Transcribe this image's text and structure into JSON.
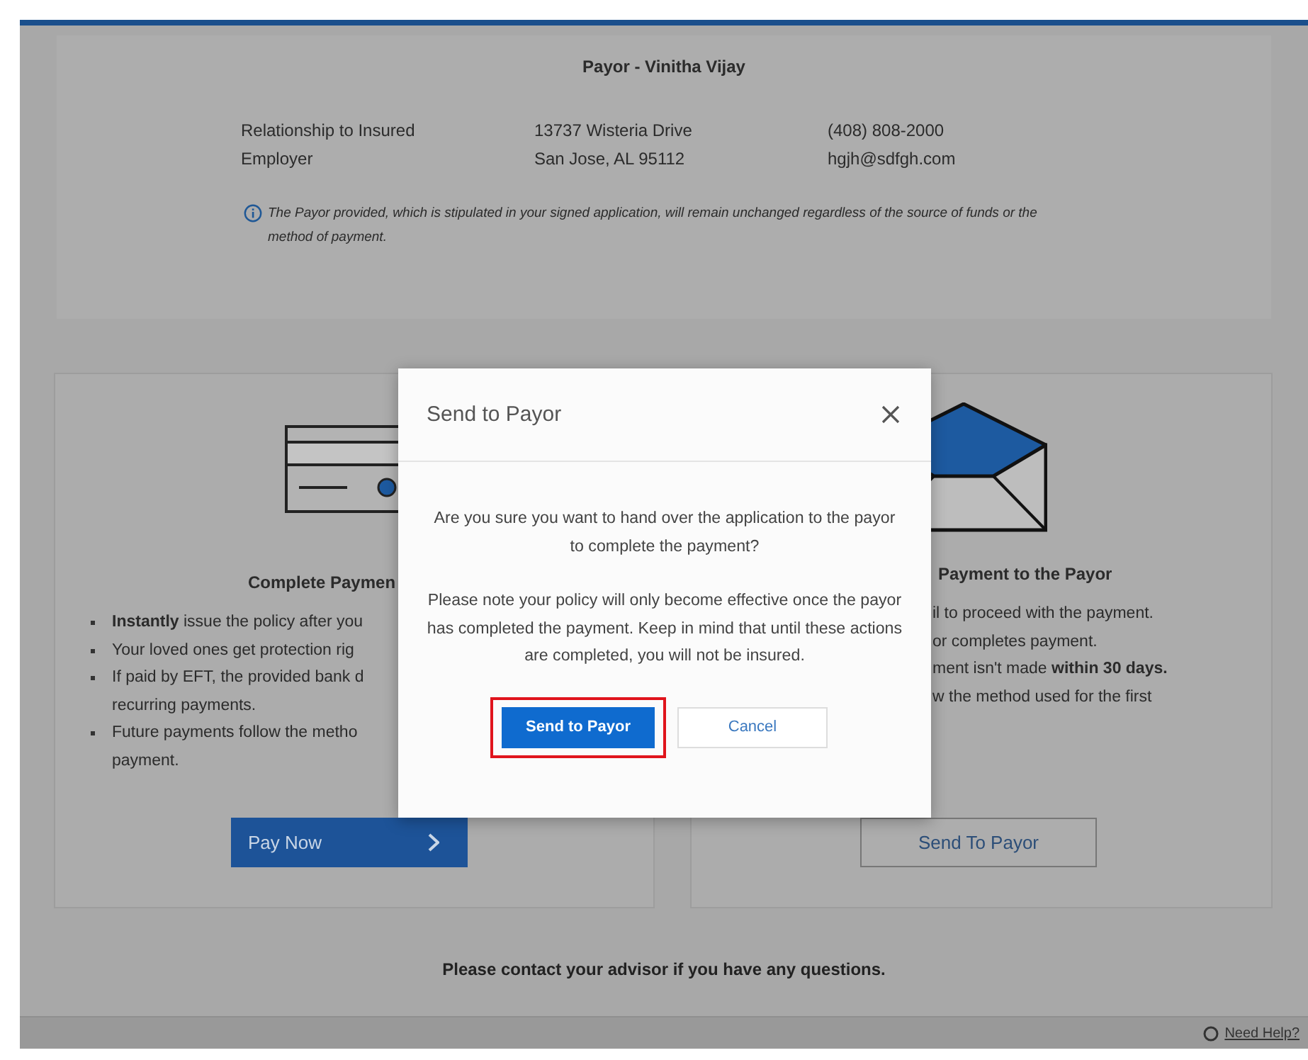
{
  "payor_panel": {
    "title": "Payor - Vinitha Vijay",
    "columns": [
      [
        "Relationship to Insured",
        "Employer"
      ],
      [
        "13737 Wisteria Drive",
        "San Jose, AL 95112"
      ],
      [
        "(408) 808-2000",
        "hgjh@sdfgh.com"
      ]
    ],
    "note": "The Payor provided, which is stipulated in your signed application, will remain unchanged regardless of the source of funds or the method of payment."
  },
  "cards": [
    {
      "kind": "card",
      "title": "Complete Paymen",
      "bullet_markers": true,
      "bullets": [
        [
          "**Instantly** issue the policy after you"
        ],
        [
          "Your loved ones get protection rig"
        ],
        [
          "If paid by EFT, the provided bank d",
          "recurring payments."
        ],
        [
          "Future payments follow the metho",
          "payment."
        ]
      ],
      "button": {
        "label": "Pay Now",
        "kind": "primary"
      }
    },
    {
      "kind": "envelope",
      "title": "Payment to the Payor",
      "bullet_markers": false,
      "bullets": [
        [
          "il to proceed with the payment."
        ],
        [
          "or completes payment."
        ],
        [
          "ment isn't made **within 30 days.**"
        ],
        [
          "w the method used for the first"
        ]
      ],
      "button": {
        "label": "Send To Payor",
        "kind": "outline"
      }
    }
  ],
  "footer": "Please contact your advisor if you have any questions.",
  "help_link": "Need Help?",
  "dialog": {
    "title": "Send to Payor",
    "paragraphs": [
      "Are you sure you want to hand over the application to the payor to complete the payment?",
      "Please note your policy will only become effective once the payor has completed the payment. Keep in mind that until these actions are completed, you will not be insured."
    ],
    "buttons": [
      {
        "label": "Send to Payor",
        "kind": "primary",
        "highlighted": true
      },
      {
        "label": "Cancel",
        "kind": "secondary",
        "highlighted": false
      }
    ]
  }
}
